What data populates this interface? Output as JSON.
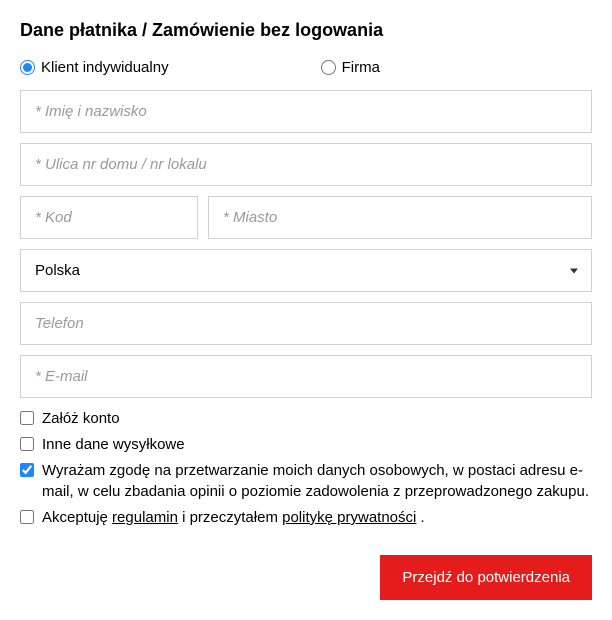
{
  "title": "Dane płatnika / Zamówienie bez logowania",
  "customer_type": {
    "individual": {
      "label": "Klient indywidualny",
      "checked": true
    },
    "company": {
      "label": "Firma",
      "checked": false
    }
  },
  "fields": {
    "name": {
      "placeholder": "* Imię i nazwisko",
      "value": ""
    },
    "street": {
      "placeholder": "* Ulica nr domu / nr lokalu",
      "value": ""
    },
    "postal": {
      "placeholder": "* Kod",
      "value": ""
    },
    "city": {
      "placeholder": "* Miasto",
      "value": ""
    },
    "country": {
      "value": "Polska"
    },
    "phone": {
      "placeholder": "Telefon",
      "value": ""
    },
    "email": {
      "placeholder": "* E-mail",
      "value": ""
    }
  },
  "checkboxes": {
    "create_account": {
      "label": "Załóż konto",
      "checked": false
    },
    "other_shipping": {
      "label": "Inne dane wysyłkowe",
      "checked": false
    },
    "consent_opinion": {
      "label": "Wyrażam zgodę na przetwarzanie moich danych osobowych, w postaci adresu e-mail, w celu zbadania opinii o poziomie zadowolenia z przeprowadzonego zakupu.",
      "checked": true
    },
    "accept_terms": {
      "prefix": "Akceptuję ",
      "link1": "regulamin",
      "mid": " i przeczytałem ",
      "link2": "politykę prywatności",
      "suffix": " .",
      "checked": false
    }
  },
  "submit_label": "Przejdź do potwierdzenia"
}
